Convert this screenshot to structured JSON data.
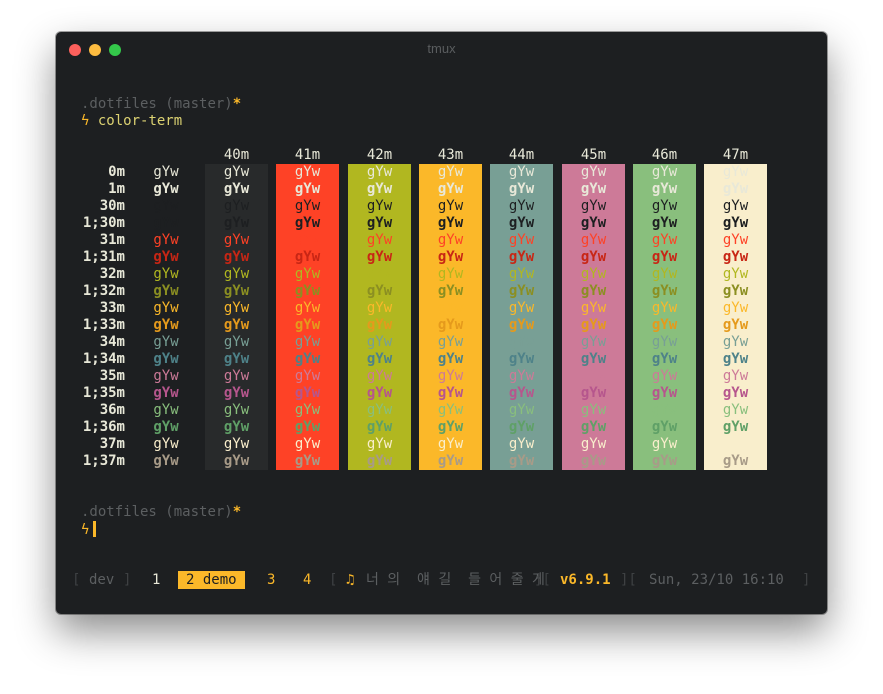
{
  "window": {
    "title": "tmux"
  },
  "prompt1": {
    "dir": ".dotfiles",
    "branch": "(master)",
    "dirty": "*",
    "bolt": "ϟ",
    "command": "color-term"
  },
  "prompt2": {
    "dir": ".dotfiles",
    "branch": "(master)",
    "dirty": "*",
    "bolt": "ϟ"
  },
  "colortable": {
    "sample": "gYw",
    "bg_headers": [
      "40m",
      "41m",
      "42m",
      "43m",
      "44m",
      "45m",
      "46m",
      "47m"
    ],
    "bg_colors": [
      "#282a2b",
      "#fe4226",
      "#b1b720",
      "#fbb829",
      "#789f95",
      "#cd7a98",
      "#89bf7d",
      "#f9eecc"
    ],
    "rows": [
      {
        "label": "0m",
        "fg": "#e8e8d8",
        "bold": false
      },
      {
        "label": "1m",
        "fg": "#e8e8d8",
        "bold": true
      },
      {
        "label": "30m",
        "fg": "#1d1f21",
        "bold": false
      },
      {
        "label": "1;30m",
        "fg": "#1d1f21",
        "bold": true
      },
      {
        "label": "31m",
        "fg": "#fe4226",
        "bold": false
      },
      {
        "label": "1;31m",
        "fg": "#c82615",
        "bold": true
      },
      {
        "label": "32m",
        "fg": "#b1b720",
        "bold": false
      },
      {
        "label": "1;32m",
        "fg": "#8b8f22",
        "bold": true
      },
      {
        "label": "33m",
        "fg": "#fbb829",
        "bold": false
      },
      {
        "label": "1;33m",
        "fg": "#e59a1c",
        "bold": true
      },
      {
        "label": "34m",
        "fg": "#789f95",
        "bold": false
      },
      {
        "label": "1;34m",
        "fg": "#4e8289",
        "bold": true
      },
      {
        "label": "35m",
        "fg": "#cd7a98",
        "bold": false
      },
      {
        "label": "1;35m",
        "fg": "#b6568d",
        "bold": true
      },
      {
        "label": "36m",
        "fg": "#89bf7d",
        "bold": false
      },
      {
        "label": "1;36m",
        "fg": "#5fa067",
        "bold": true
      },
      {
        "label": "37m",
        "fg": "#f9eecc",
        "bold": false
      },
      {
        "label": "1;37m",
        "fg": "#a89b88",
        "bold": true
      }
    ]
  },
  "statusbar": {
    "session": "dev",
    "windows": [
      {
        "label": "1",
        "active": false
      },
      {
        "label": "2 demo",
        "active": true
      },
      {
        "label": "3",
        "active": false
      },
      {
        "label": "4",
        "active": false
      }
    ],
    "music_icon": "♫",
    "song": "너 의  얘 길  들 어 줄 게",
    "version": "v6.9.1",
    "datetime": "Sun, 23/10 16:10",
    "bracket_open": "[",
    "bracket_close": "]",
    "bracket_join": "][",
    "colors": {
      "accent": "#fbb829",
      "muted": "#5c5f61"
    }
  }
}
